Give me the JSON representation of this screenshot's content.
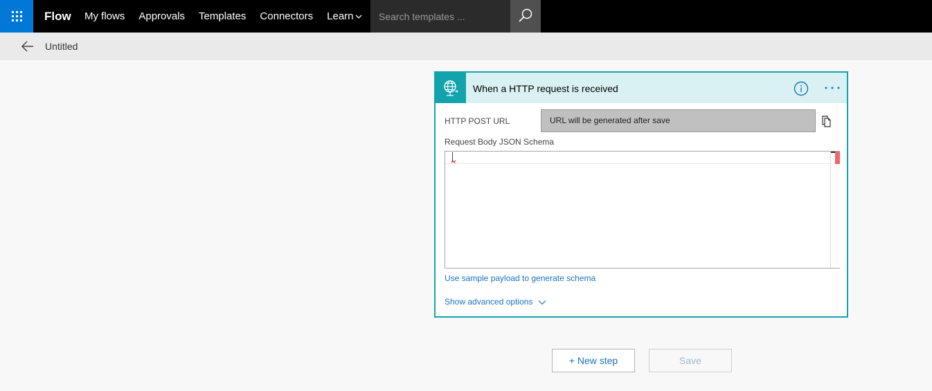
{
  "nav": {
    "brand": "Flow",
    "links": [
      "My flows",
      "Approvals",
      "Templates",
      "Connectors"
    ],
    "learn": "Learn",
    "search_placeholder": "Search templates ..."
  },
  "subheader": {
    "title": "Untitled"
  },
  "card": {
    "title": "When a HTTP request is received",
    "url_label": "HTTP POST URL",
    "url_value": "URL will be generated after save",
    "schema_label": "Request Body JSON Schema",
    "sample_link": "Use sample payload to generate schema",
    "advanced_link": "Show advanced options"
  },
  "actions": {
    "new_step": "+ New step",
    "save": "Save"
  },
  "colors": {
    "accent": "#0078d7",
    "card_border": "#13a3ac",
    "card_header": "#d9f1f3",
    "link": "#1a73c0"
  }
}
